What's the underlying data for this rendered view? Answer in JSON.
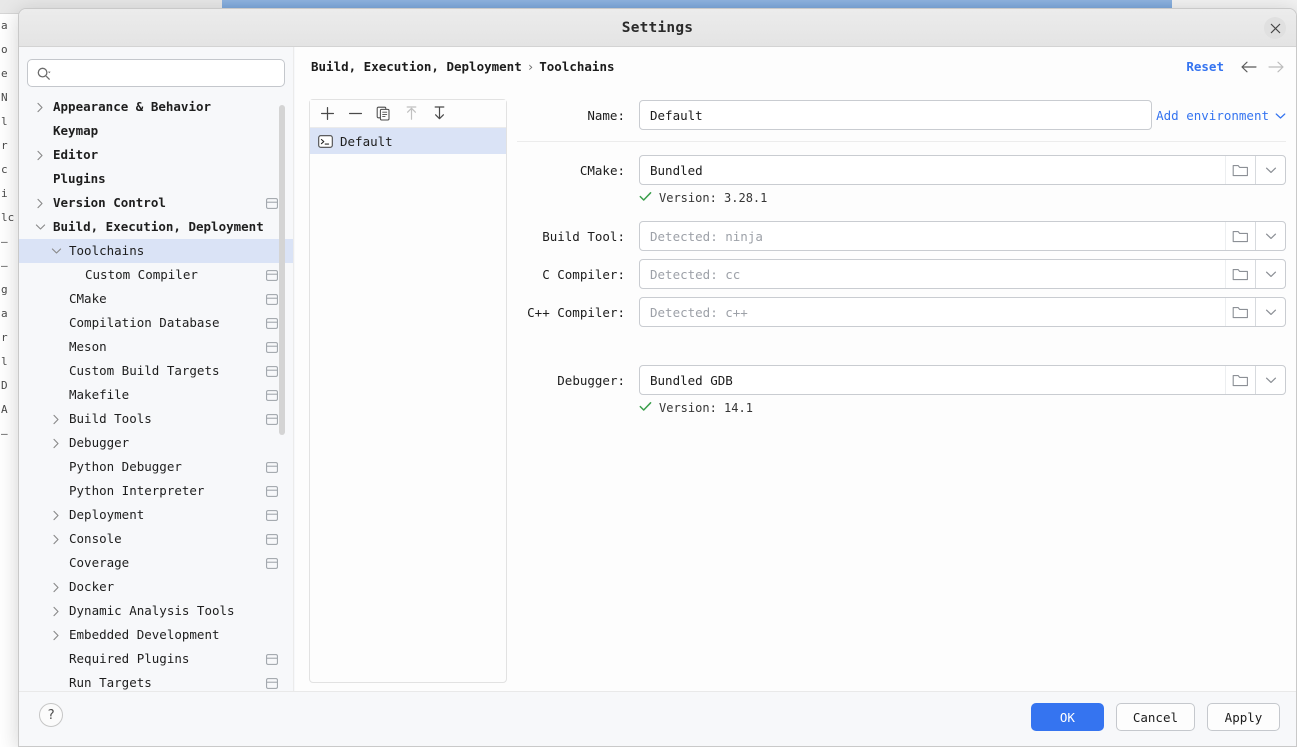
{
  "background": {
    "left_column_lines": [
      "a",
      "o",
      "e",
      "N",
      "l",
      "r",
      "c",
      "i",
      "lc",
      "",
      "",
      "—",
      "—",
      "g",
      "a",
      "r",
      "l",
      "D",
      "A",
      "—"
    ]
  },
  "window": {
    "title": "Settings",
    "close_icon": "close-icon"
  },
  "search": {
    "value": "",
    "placeholder": "",
    "icon": "search-icon"
  },
  "sidebar": {
    "items": [
      {
        "label": "Appearance & Behavior",
        "indent": 0,
        "arrow": "right",
        "bold": true,
        "scope": false,
        "selected": false
      },
      {
        "label": "Keymap",
        "indent": 0,
        "arrow": "none",
        "bold": true,
        "scope": false,
        "selected": false
      },
      {
        "label": "Editor",
        "indent": 0,
        "arrow": "right",
        "bold": true,
        "scope": false,
        "selected": false
      },
      {
        "label": "Plugins",
        "indent": 0,
        "arrow": "none",
        "bold": true,
        "scope": false,
        "selected": false
      },
      {
        "label": "Version Control",
        "indent": 0,
        "arrow": "right",
        "bold": true,
        "scope": true,
        "selected": false
      },
      {
        "label": "Build, Execution, Deployment",
        "indent": 0,
        "arrow": "down",
        "bold": true,
        "scope": false,
        "selected": false
      },
      {
        "label": "Toolchains",
        "indent": 1,
        "arrow": "down",
        "bold": false,
        "scope": false,
        "selected": true
      },
      {
        "label": "Custom Compiler",
        "indent": 2,
        "arrow": "none",
        "bold": false,
        "scope": true,
        "selected": false
      },
      {
        "label": "CMake",
        "indent": 1,
        "arrow": "none",
        "bold": false,
        "scope": true,
        "selected": false
      },
      {
        "label": "Compilation Database",
        "indent": 1,
        "arrow": "none",
        "bold": false,
        "scope": true,
        "selected": false
      },
      {
        "label": "Meson",
        "indent": 1,
        "arrow": "none",
        "bold": false,
        "scope": true,
        "selected": false
      },
      {
        "label": "Custom Build Targets",
        "indent": 1,
        "arrow": "none",
        "bold": false,
        "scope": true,
        "selected": false
      },
      {
        "label": "Makefile",
        "indent": 1,
        "arrow": "none",
        "bold": false,
        "scope": true,
        "selected": false
      },
      {
        "label": "Build Tools",
        "indent": 1,
        "arrow": "right",
        "bold": false,
        "scope": true,
        "selected": false
      },
      {
        "label": "Debugger",
        "indent": 1,
        "arrow": "right",
        "bold": false,
        "scope": false,
        "selected": false
      },
      {
        "label": "Python Debugger",
        "indent": 1,
        "arrow": "none",
        "bold": false,
        "scope": true,
        "selected": false
      },
      {
        "label": "Python Interpreter",
        "indent": 1,
        "arrow": "none",
        "bold": false,
        "scope": true,
        "selected": false
      },
      {
        "label": "Deployment",
        "indent": 1,
        "arrow": "right",
        "bold": false,
        "scope": true,
        "selected": false
      },
      {
        "label": "Console",
        "indent": 1,
        "arrow": "right",
        "bold": false,
        "scope": true,
        "selected": false
      },
      {
        "label": "Coverage",
        "indent": 1,
        "arrow": "none",
        "bold": false,
        "scope": true,
        "selected": false
      },
      {
        "label": "Docker",
        "indent": 1,
        "arrow": "right",
        "bold": false,
        "scope": false,
        "selected": false
      },
      {
        "label": "Dynamic Analysis Tools",
        "indent": 1,
        "arrow": "right",
        "bold": false,
        "scope": false,
        "selected": false
      },
      {
        "label": "Embedded Development",
        "indent": 1,
        "arrow": "right",
        "bold": false,
        "scope": false,
        "selected": false
      },
      {
        "label": "Required Plugins",
        "indent": 1,
        "arrow": "none",
        "bold": false,
        "scope": true,
        "selected": false
      },
      {
        "label": "Run Targets",
        "indent": 1,
        "arrow": "none",
        "bold": false,
        "scope": true,
        "selected": false
      }
    ]
  },
  "header": {
    "breadcrumb_parent": "Build, Execution, Deployment",
    "breadcrumb_separator": "›",
    "breadcrumb_current": "Toolchains",
    "reset_label": "Reset",
    "back_icon": "arrow-left-icon",
    "forward_icon": "arrow-right-icon"
  },
  "toolchain_list": {
    "toolbar": [
      {
        "name": "add-toolchain-button",
        "glyph": "plus",
        "disabled": false
      },
      {
        "name": "remove-toolchain-button",
        "glyph": "minus",
        "disabled": false
      },
      {
        "name": "copy-toolchain-button",
        "glyph": "copy",
        "disabled": false
      },
      {
        "name": "move-up-toolchain-button",
        "glyph": "arrow-up",
        "disabled": true
      },
      {
        "name": "move-down-toolchain-button",
        "glyph": "arrow-down",
        "disabled": false
      }
    ],
    "items": [
      {
        "label": "Default",
        "icon": "terminal-icon",
        "selected": true
      }
    ]
  },
  "form": {
    "add_environment_label": "Add environment",
    "add_environment_icon": "chevron-down-icon",
    "rows": [
      {
        "label": "Name:",
        "value": "Default",
        "is_placeholder": false,
        "has_browse": false,
        "has_dropdown": false,
        "version": null
      },
      {
        "label": "CMake:",
        "value": "Bundled",
        "is_placeholder": false,
        "has_browse": true,
        "has_dropdown": true,
        "version": "Version: 3.28.1"
      },
      {
        "label": "Build Tool:",
        "value": "Detected: ninja",
        "is_placeholder": true,
        "has_browse": true,
        "has_dropdown": true,
        "version": null
      },
      {
        "label": "C Compiler:",
        "value": "Detected: cc",
        "is_placeholder": true,
        "has_browse": true,
        "has_dropdown": true,
        "version": null
      },
      {
        "label": "C++ Compiler:",
        "value": "Detected: c++",
        "is_placeholder": true,
        "has_browse": true,
        "has_dropdown": true,
        "version": null
      },
      {
        "label": "Debugger:",
        "value": "Bundled GDB",
        "is_placeholder": false,
        "has_browse": true,
        "has_dropdown": true,
        "version": "Version: 14.1"
      }
    ]
  },
  "footer": {
    "help_label": "?",
    "ok_label": "OK",
    "cancel_label": "Cancel",
    "apply_label": "Apply"
  },
  "colors": {
    "accent": "#3574f0",
    "selection": "#dae3f6",
    "success": "#3a9e4b",
    "dialog_bg": "#f7f8fa"
  }
}
